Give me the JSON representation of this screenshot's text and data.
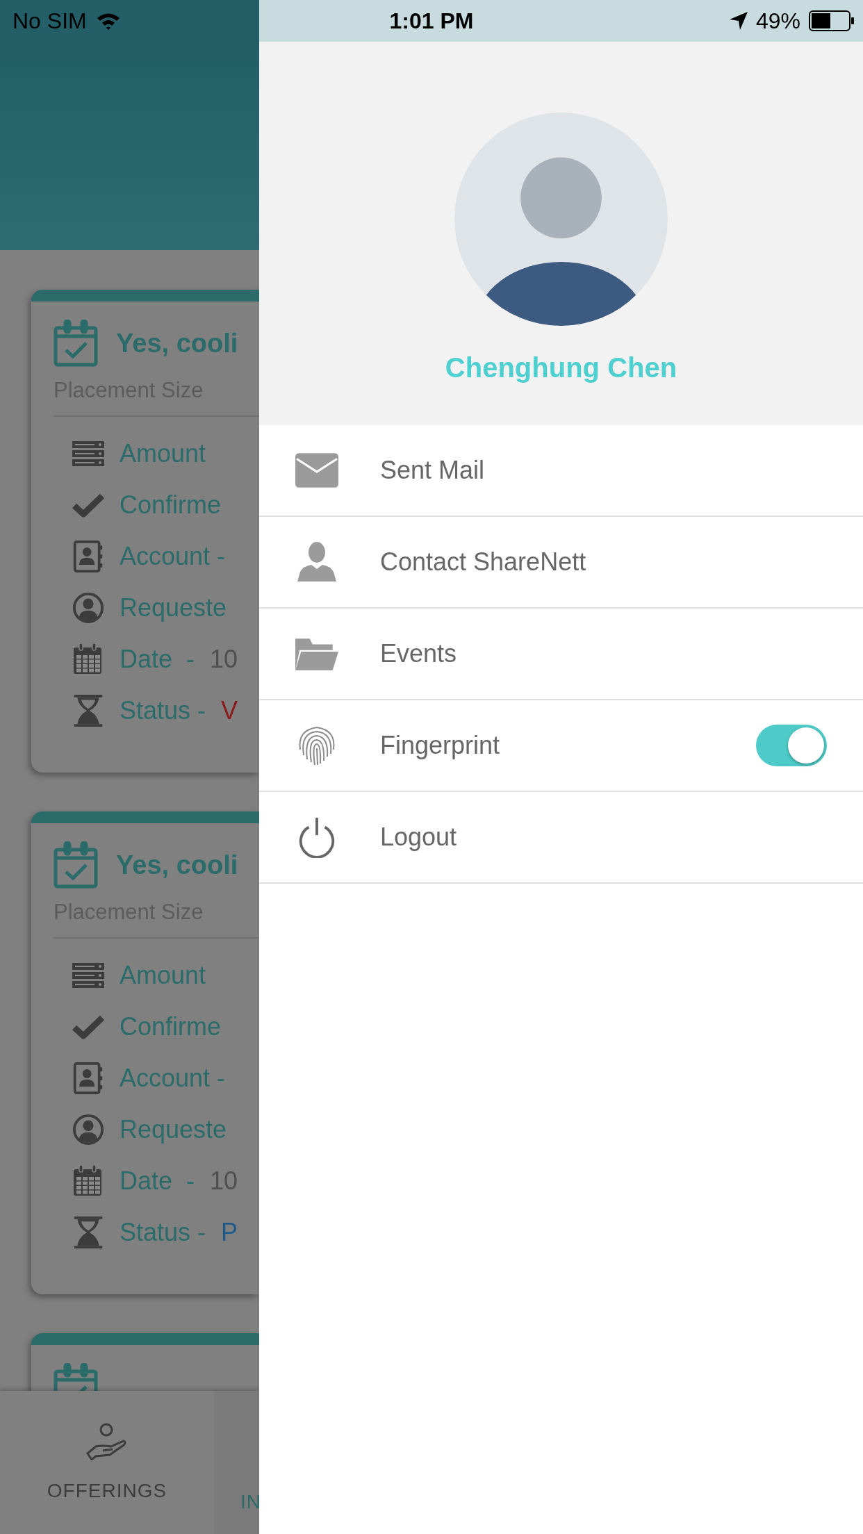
{
  "status_bar": {
    "carrier": "No SIM",
    "time": "1:01 PM",
    "battery": "49%"
  },
  "background_screen": {
    "cards": [
      {
        "kind": "full",
        "title": "Yes, cooli",
        "subtitle": "Placement Size",
        "fields": [
          {
            "kind": "amount",
            "label": "Amount"
          },
          {
            "kind": "confirmed",
            "label": "Confirme"
          },
          {
            "kind": "account",
            "label": "Account -"
          },
          {
            "kind": "requester",
            "label": "Requeste"
          },
          {
            "kind": "date",
            "label": "Date  -",
            "value": "10"
          },
          {
            "kind": "status",
            "label": "Status -",
            "value": "V",
            "color": "#8b1c1c"
          }
        ]
      },
      {
        "kind": "full",
        "title": "Yes, cooli",
        "subtitle": "Placement Size",
        "fields": [
          {
            "kind": "amount",
            "label": "Amount"
          },
          {
            "kind": "confirmed",
            "label": "Confirme"
          },
          {
            "kind": "account",
            "label": "Account -"
          },
          {
            "kind": "requester",
            "label": "Requeste"
          },
          {
            "kind": "date",
            "label": "Date  -",
            "value": "10"
          },
          {
            "kind": "status",
            "label": "Status -",
            "value": "P",
            "color": "#1f5a8a"
          }
        ]
      },
      {
        "kind": "partial"
      }
    ],
    "tabs": [
      {
        "kind": "offerings",
        "label": "OFFERINGS",
        "selected": false
      },
      {
        "kind": "other",
        "label": "IN",
        "selected": true
      }
    ]
  },
  "drawer": {
    "profile": {
      "name": "Chenghung Chen"
    },
    "menu": [
      {
        "kind": "mail",
        "label": "Sent Mail"
      },
      {
        "kind": "contact",
        "label": "Contact ShareNett"
      },
      {
        "kind": "folder",
        "label": "Events"
      },
      {
        "kind": "fingerprint",
        "label": "Fingerprint",
        "toggle": {
          "on": true
        }
      },
      {
        "kind": "power",
        "label": "Logout"
      }
    ]
  }
}
